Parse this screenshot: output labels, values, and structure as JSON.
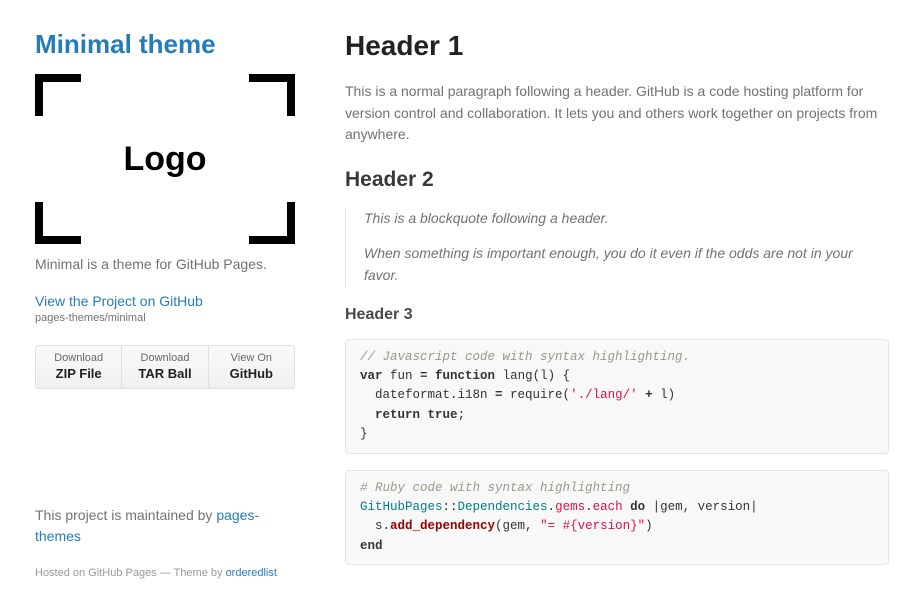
{
  "sidebar": {
    "title": "Minimal theme",
    "logo_text": "Logo",
    "tagline": "Minimal is a theme for GitHub Pages.",
    "view_link": "View the Project on GitHub",
    "repo_slug": "pages-themes/minimal",
    "downloads": [
      {
        "small": "Download",
        "big": "ZIP File"
      },
      {
        "small": "Download",
        "big": "TAR Ball"
      },
      {
        "small": "View On",
        "big": "GitHub"
      }
    ],
    "maintained_prefix": "This project is maintained by ",
    "maintained_link": "pages-themes",
    "hosted_prefix": "Hosted on GitHub Pages — Theme by ",
    "hosted_link": "orderedlist"
  },
  "content": {
    "h1": "Header 1",
    "p1": "This is a normal paragraph following a header. GitHub is a code hosting platform for version control and collaboration. It lets you and others work together on projects from anywhere.",
    "h2": "Header 2",
    "bq1": "This is a blockquote following a header.",
    "bq2": "When something is important enough, you do it even if the odds are not in your favor.",
    "h3": "Header 3",
    "code1": {
      "c": "// Javascript code with syntax highlighting.",
      "l1a": "var",
      "l1b": " fun ",
      "l1c": "=",
      "l1d": " function",
      "l1e": " lang(l) {",
      "l2a": "  dateformat.i18n ",
      "l2b": "=",
      "l2c": " require(",
      "l2d": "'./lang/'",
      "l2e": " ",
      "l2f": "+",
      "l2g": " l)",
      "l3a": "  ",
      "l3b": "return",
      "l3c": " ",
      "l3d": "true",
      "l3e": ";",
      "l4": "}"
    },
    "code2": {
      "c": "# Ruby code with syntax highlighting",
      "l1a": "GitHubPages",
      "l1b": "::",
      "l1c": "Dependencies",
      "l1d": ".",
      "l1e": "gems",
      "l1f": ".",
      "l1g": "each",
      "l1h": " ",
      "l1i": "do",
      "l1j": " |gem, version|",
      "l2a": "  s.",
      "l2b": "add_dependency",
      "l2c": "(gem, ",
      "l2d": "\"= #{version}\"",
      "l2e": ")",
      "l3": "end"
    }
  }
}
